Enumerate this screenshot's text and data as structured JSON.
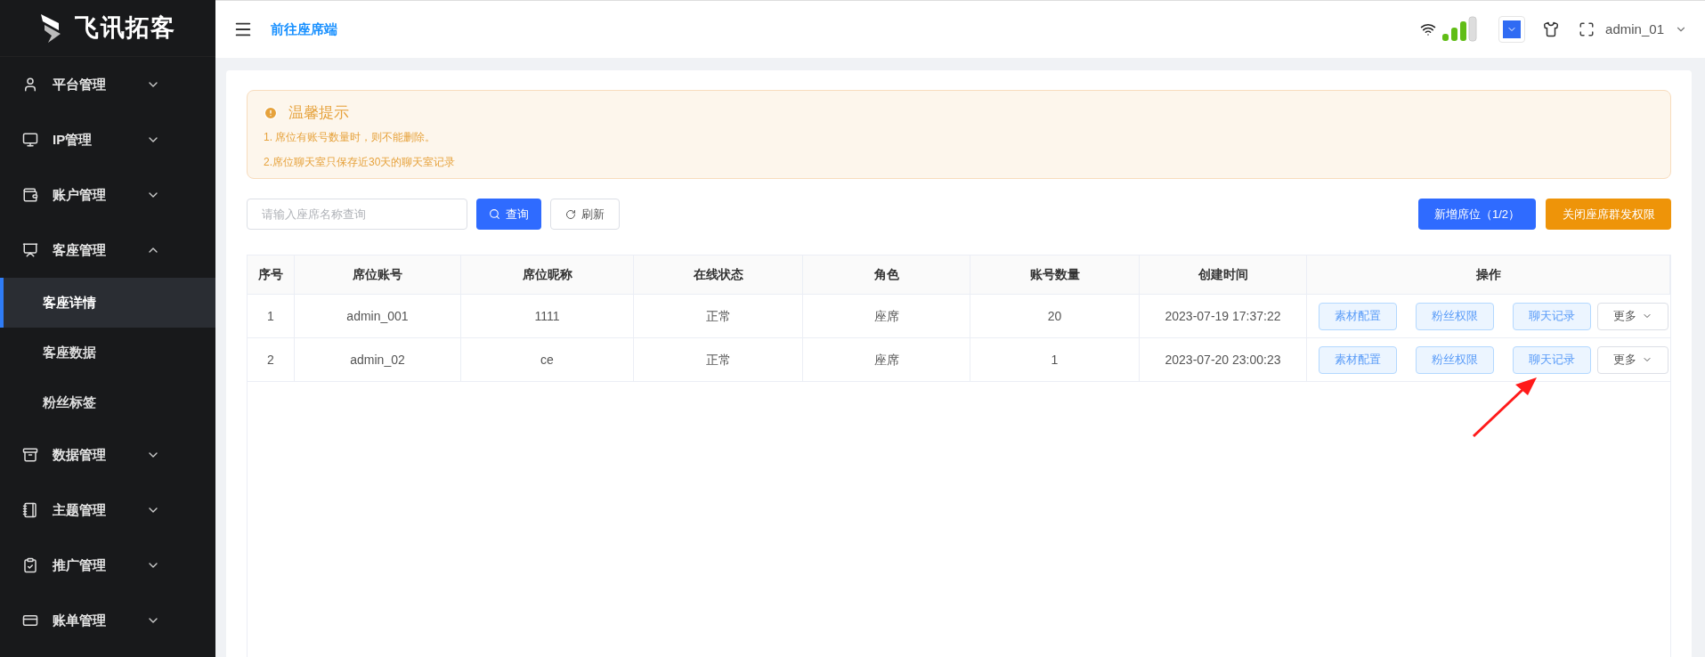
{
  "brand": {
    "name": "飞讯拓客"
  },
  "sidebar": {
    "items": [
      {
        "label": "平台管理",
        "expanded": false
      },
      {
        "label": "IP管理",
        "expanded": false
      },
      {
        "label": "账户管理",
        "expanded": false
      },
      {
        "label": "客座管理",
        "expanded": true,
        "children": [
          {
            "label": "客座详情",
            "selected": true
          },
          {
            "label": "客座数据",
            "selected": false
          },
          {
            "label": "粉丝标签",
            "selected": false
          }
        ]
      },
      {
        "label": "数据管理",
        "expanded": false
      },
      {
        "label": "主题管理",
        "expanded": false
      },
      {
        "label": "推广管理",
        "expanded": false
      },
      {
        "label": "账单管理",
        "expanded": false
      }
    ]
  },
  "header": {
    "link": "前往座席端",
    "user": "admin_01"
  },
  "notice": {
    "title": "温馨提示",
    "lines": [
      "1. 席位有账号数量时，则不能删除。",
      "2.席位聊天室只保存近30天的聊天室记录"
    ]
  },
  "search": {
    "placeholder": "请输入座席名称查询",
    "query_button": "查询",
    "refresh_button": "刷新"
  },
  "actions": {
    "add_button": "新增席位（1/2）",
    "close_button": "关闭座席群发权限"
  },
  "table": {
    "columns": [
      "序号",
      "席位账号",
      "席位昵称",
      "在线状态",
      "角色",
      "账号数量",
      "创建时间",
      "操作"
    ],
    "rows": [
      {
        "cells": [
          "1",
          "admin_001",
          "1111",
          "正常",
          "座席",
          "20",
          "2023-07-19 17:37:22"
        ],
        "buttons": [
          "素材配置",
          "粉丝权限",
          "聊天记录"
        ],
        "more": "更多"
      },
      {
        "cells": [
          "2",
          "admin_02",
          "ce",
          "正常",
          "座席",
          "1",
          "2023-07-20 23:00:23"
        ],
        "buttons": [
          "素材配置",
          "粉丝权限",
          "聊天记录"
        ],
        "more": "更多"
      }
    ]
  }
}
